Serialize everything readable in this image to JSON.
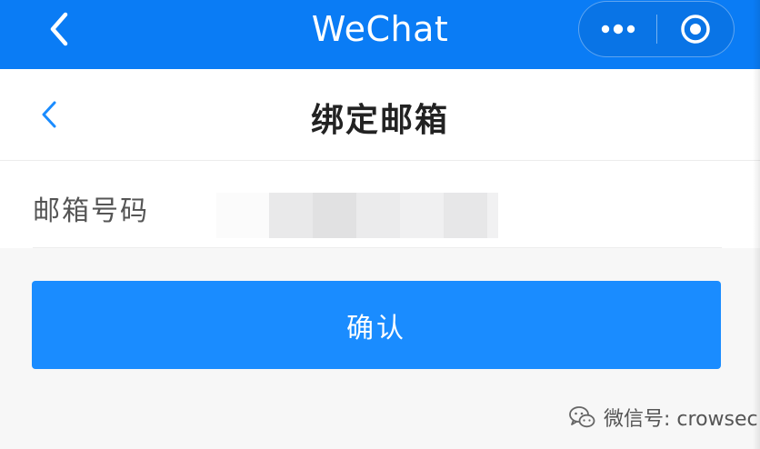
{
  "app_bar": {
    "title": "WeChat",
    "back_icon": "chevron-left-icon",
    "more_icon": "more-dots-icon",
    "close_icon": "target-circle-icon"
  },
  "page_nav": {
    "title": "绑定邮箱",
    "back_icon": "chevron-left-icon"
  },
  "form": {
    "email_label": "邮箱号码",
    "email_value_redacted": true
  },
  "confirm_button": {
    "label": "确认"
  },
  "watermark": {
    "text": "微信号: crowsec",
    "icon": "wechat-logo-icon"
  },
  "colors": {
    "app_bar_bg": "#0a7cf5",
    "button_bg": "#1a8cff",
    "accent": "#1a8cff",
    "page_bg": "#f7f7f7"
  }
}
